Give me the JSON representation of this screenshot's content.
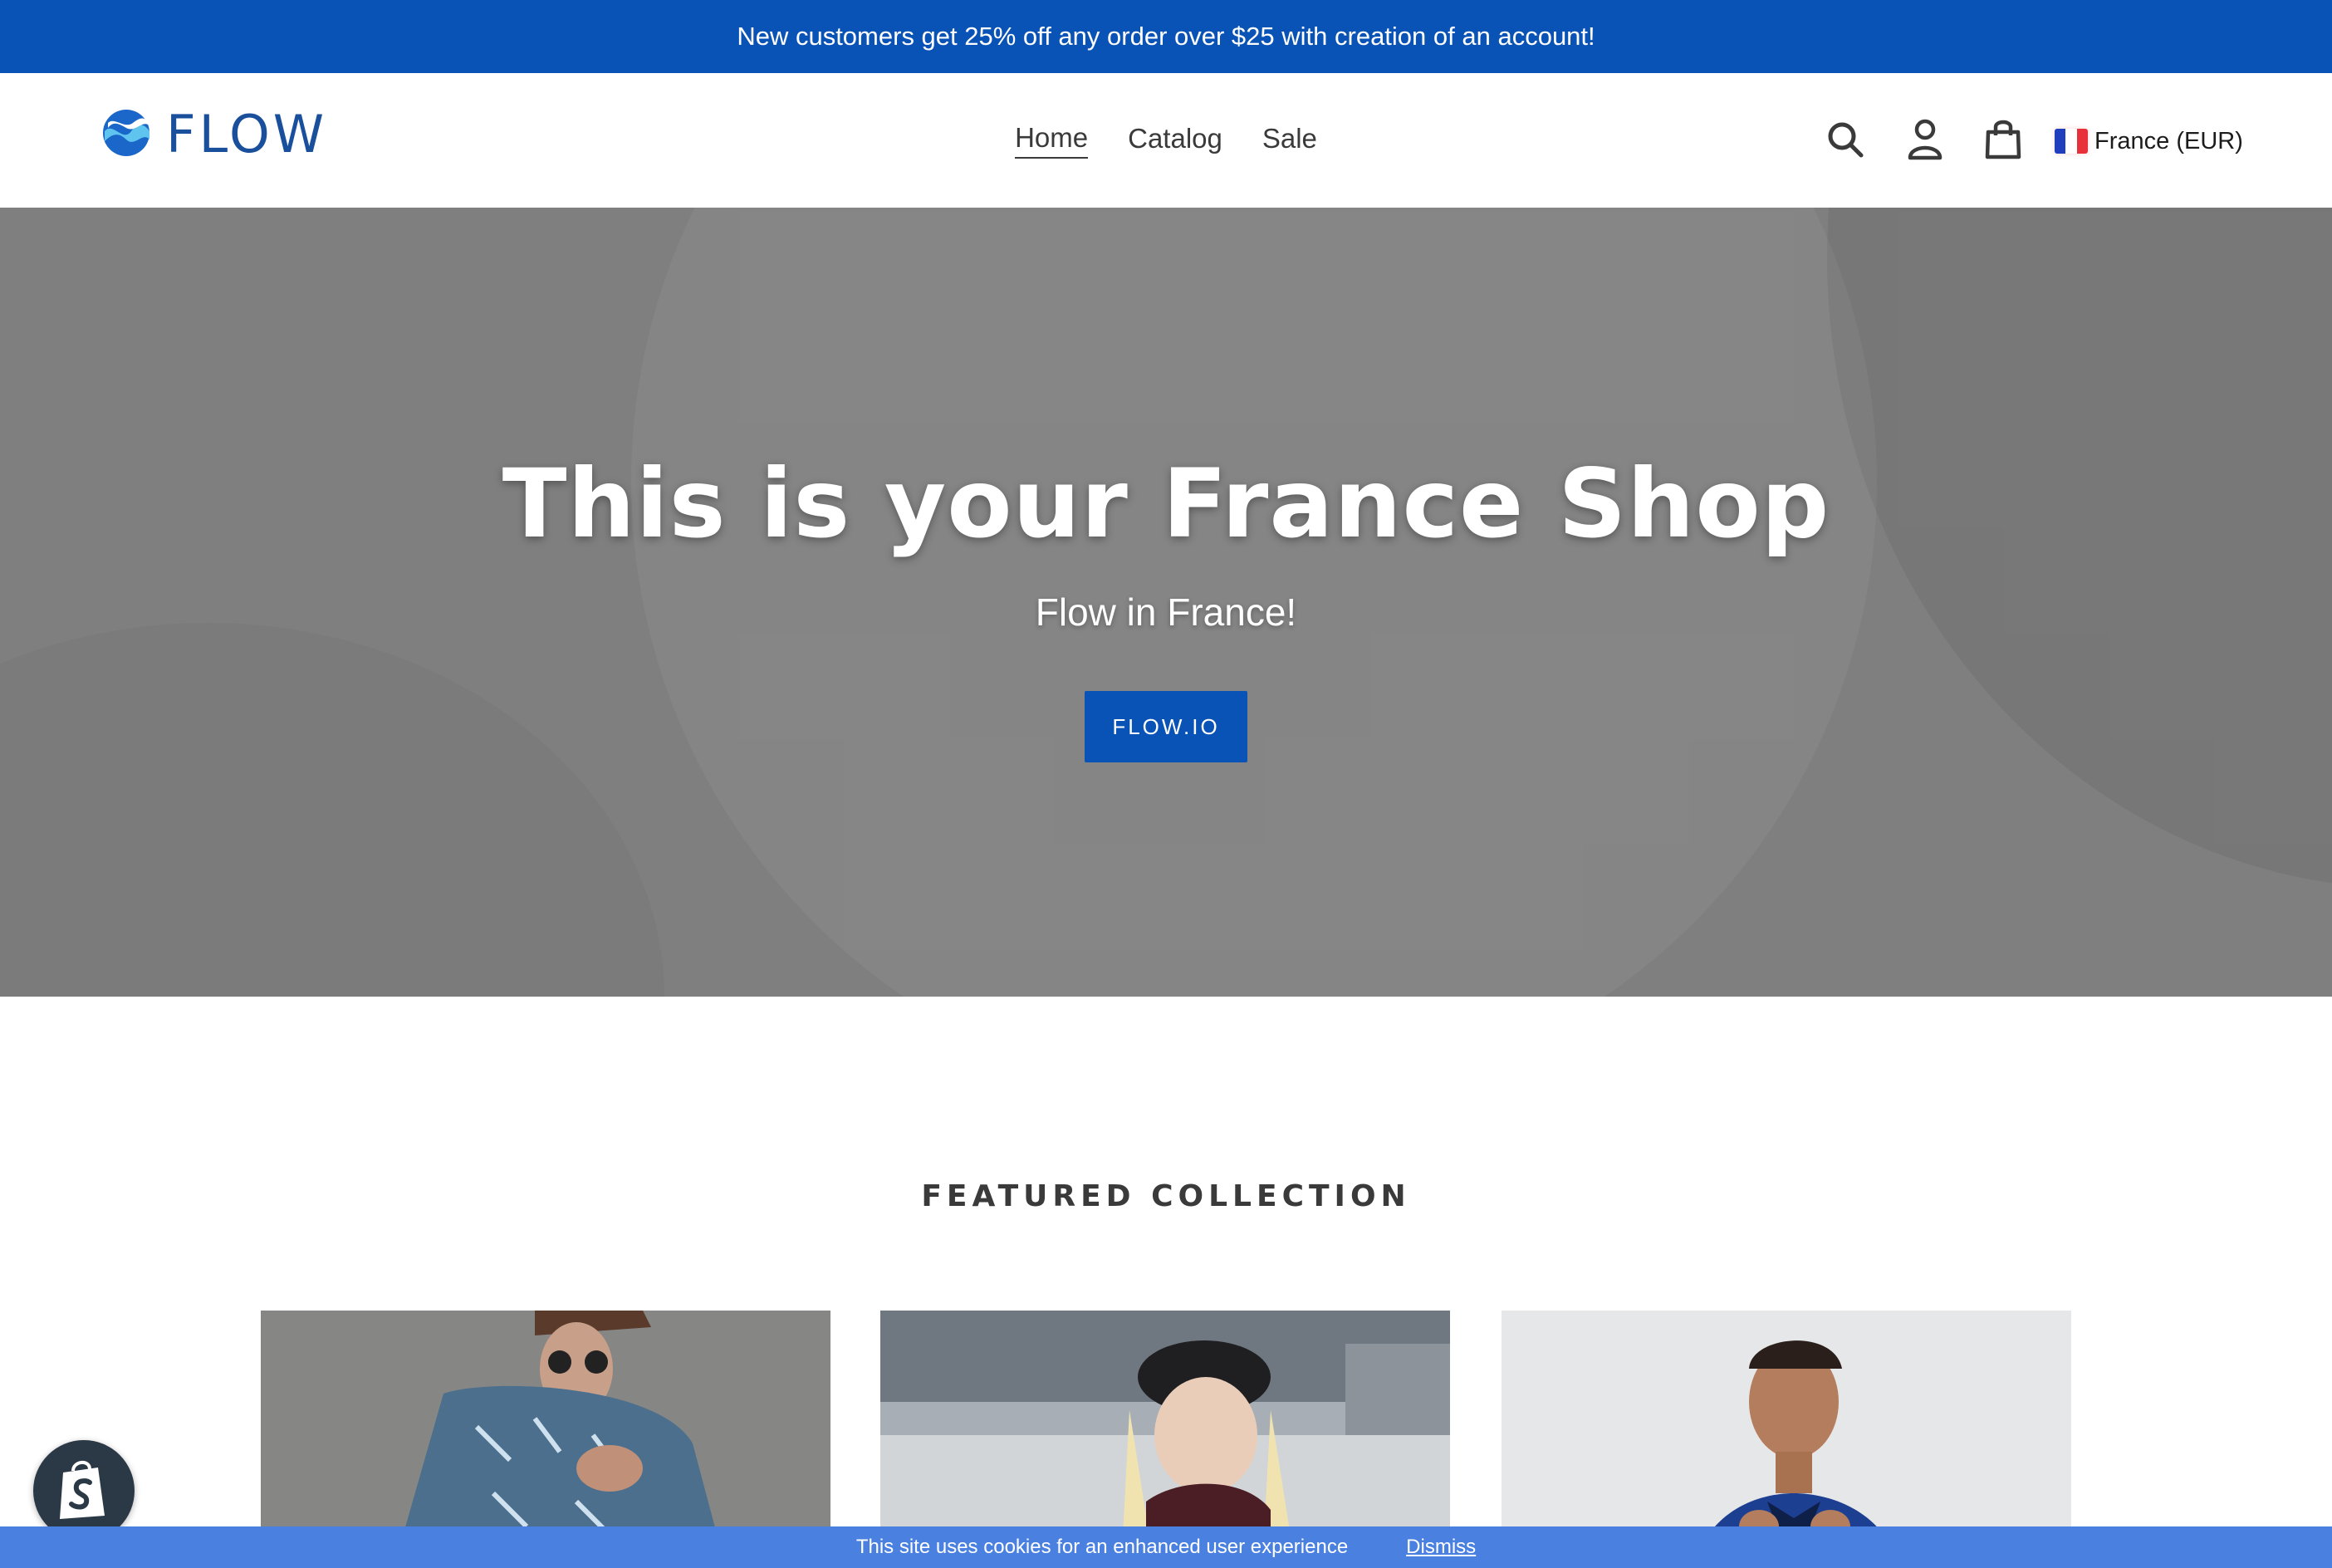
{
  "announcement": {
    "text": "New customers get 25% off any order over $25 with creation of an account!"
  },
  "header": {
    "logo_text": "FLOW",
    "nav": [
      {
        "label": "Home",
        "active": true
      },
      {
        "label": "Catalog",
        "active": false
      },
      {
        "label": "Sale",
        "active": false
      }
    ],
    "icons": [
      "search-icon",
      "account-icon",
      "cart-icon"
    ],
    "country_selector": {
      "label": "France (EUR)",
      "flag_colors": [
        "#1f3fbf",
        "#ffffff",
        "#e8303c"
      ]
    }
  },
  "hero": {
    "title": "This is your France Shop",
    "subtitle": "Flow in France!",
    "button_label": "FLOW.IO"
  },
  "featured": {
    "title": "FEATURED COLLECTION"
  },
  "cookie_banner": {
    "text": "This site uses cookies for an enhanced user experience",
    "dismiss_label": "Dismiss"
  },
  "colors": {
    "brand_blue": "#0a53b6",
    "cookie_blue": "#4a80e0",
    "text_dark": "#3a3a3a"
  }
}
